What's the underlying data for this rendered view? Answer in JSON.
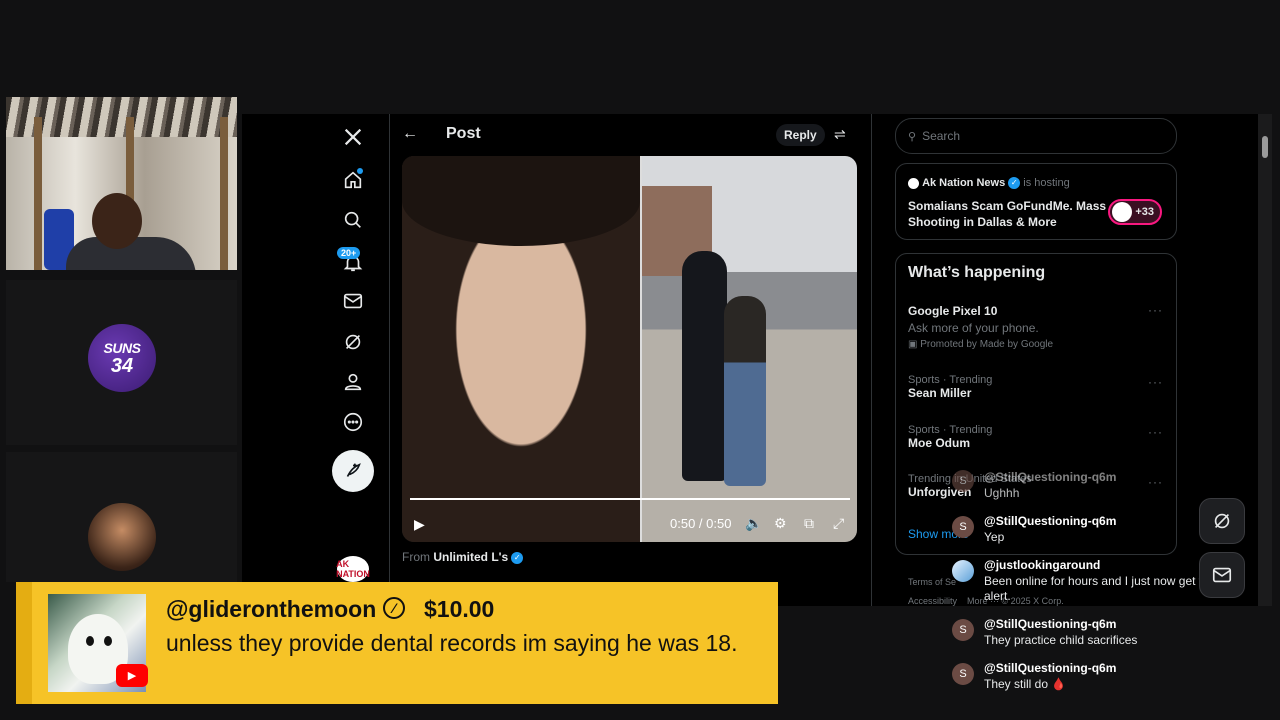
{
  "stream": {
    "team_badge": {
      "line1": "SUNS",
      "line2": "34"
    }
  },
  "x_sidebar": {
    "notification_count": "20+",
    "small_avatar_text": "AK NATION"
  },
  "post": {
    "header_title": "Post",
    "reply_label": "Reply",
    "video_time": "0:50 / 0:50",
    "progress_fraction": 1.0,
    "from_prefix": "From",
    "from_name": "Unlimited L's"
  },
  "right_column": {
    "search_placeholder": "Search",
    "space": {
      "host": "Ak Nation News",
      "host_suffix": "is hosting",
      "title": "Somalians Scam GoFundMe. Mass Shooting in Dallas & More",
      "listener_count": "+33"
    },
    "happening": {
      "title": "What’s happening",
      "trends": [
        {
          "name": "Google Pixel 10",
          "desc": "Ask more of your phone.",
          "promo": "Promoted by Made by Google"
        },
        {
          "meta": "Sports · Trending",
          "name": "Sean Miller"
        },
        {
          "meta": "Sports · Trending",
          "name": "Moe Odum"
        },
        {
          "meta": "Trending in United States",
          "name": "Unforgiven"
        }
      ],
      "show_more": "Show more"
    },
    "footer": {
      "line1": "Terms of Se",
      "line2": "Accessibility",
      "line2b": "More ···   © 2025 X Corp."
    }
  },
  "chat": [
    {
      "user": "@StillQuestioning-q6m",
      "msg": "Ughhh",
      "avatar": "S"
    },
    {
      "user": "@StillQuestioning-q6m",
      "msg": "Yep",
      "avatar": "S"
    },
    {
      "user": "@justlookingaround",
      "msg": "Been online for hours and I just now get the alert.",
      "avatar": ""
    },
    {
      "user": "@StillQuestioning-q6m",
      "msg": "They practice child sacrifices",
      "avatar": "S"
    },
    {
      "user": "@StillQuestioning-q6m",
      "msg": "They still do 🩸",
      "avatar": "S"
    }
  ],
  "superchat": {
    "user": "@glideronthemoon",
    "amount": "$10.00",
    "message": "unless they provide dental records im saying he was 18."
  },
  "colors": {
    "superchat_bg": "#f6c327",
    "x_accent": "#1d9bf0",
    "space_ring": "#f91880"
  }
}
